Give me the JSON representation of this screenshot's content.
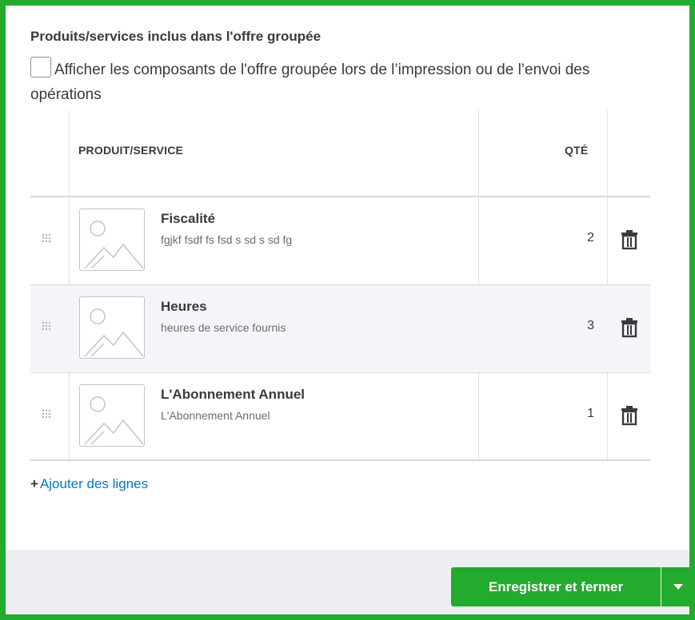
{
  "section": {
    "title": "Produits/services inclus dans l'offre groupée",
    "checkbox_label": "Afficher les composants de l'offre groupée lors de l’impression ou de l’envoi des opérations",
    "checkbox_checked": false
  },
  "table": {
    "headers": {
      "product": "PRODUIT/SERVICE",
      "qty": "QTÉ"
    },
    "rows": [
      {
        "name": "Fiscalité",
        "description": "fgjkf fsdf fs fsd s sd s sd fg",
        "qty": "2"
      },
      {
        "name": "Heures",
        "description": "heures de service fournis",
        "qty": "3"
      },
      {
        "name": "L'Abonnement Annuel",
        "description": "L'Abonnement Annuel",
        "qty": "1"
      }
    ]
  },
  "add_lines": {
    "plus": "+",
    "label": "Ajouter des lignes"
  },
  "footer": {
    "save_label": "Enregistrer et fermer"
  },
  "colors": {
    "accent_green": "#22ab2c",
    "link_blue": "#0077c5",
    "footer_bg": "#eceef1"
  },
  "icons": [
    "drag-handle-icon",
    "image-placeholder-icon",
    "trash-icon",
    "caret-down-icon"
  ]
}
